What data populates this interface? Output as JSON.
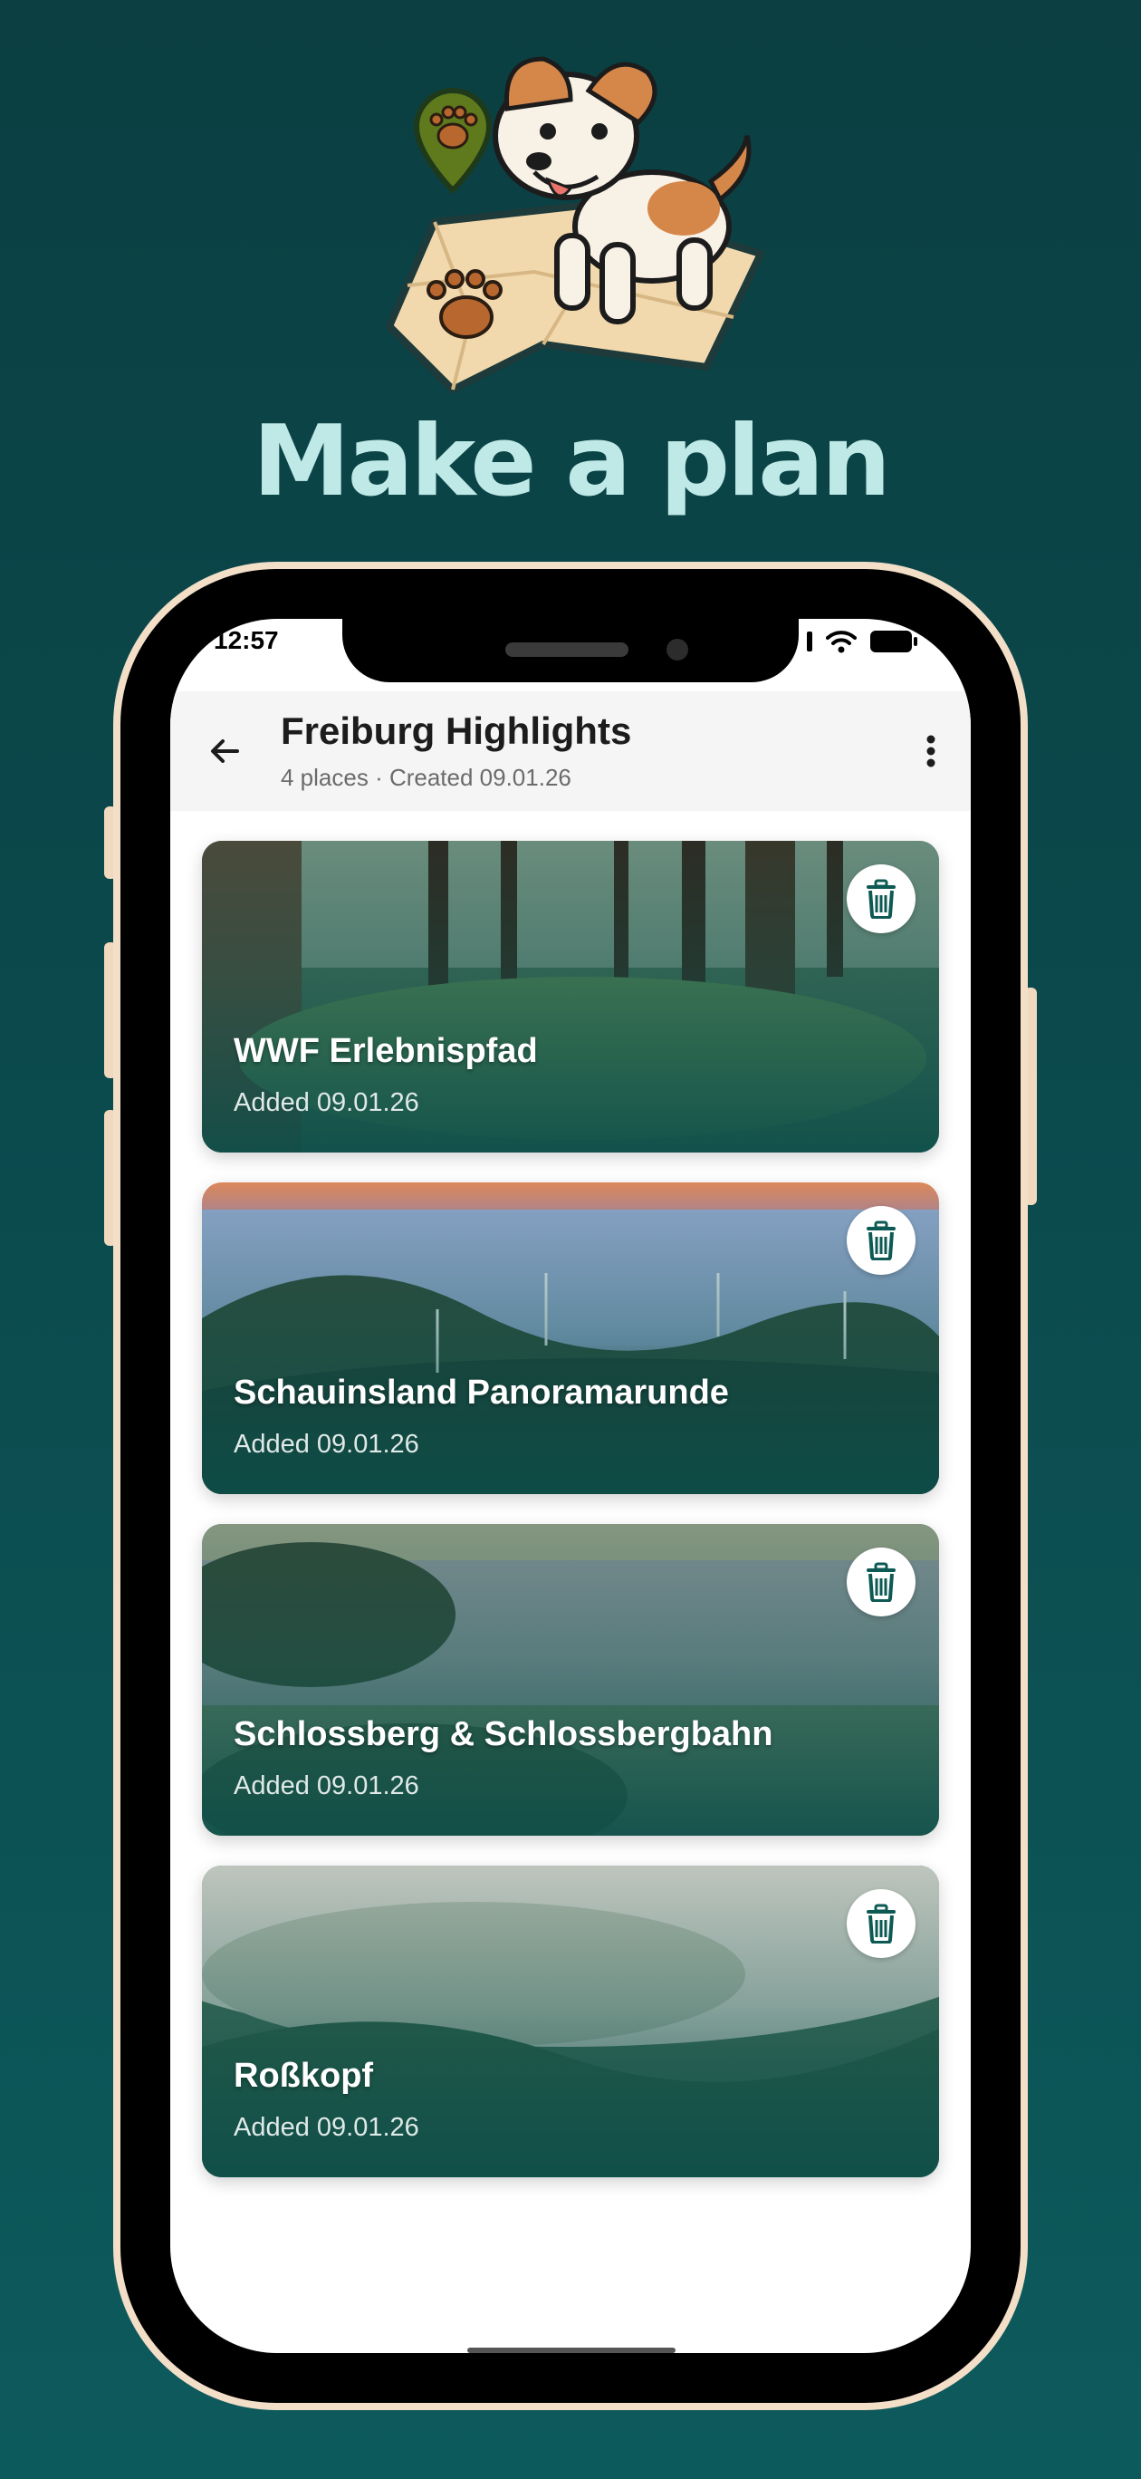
{
  "headline": "Make a plan",
  "status_bar": {
    "time": "12:57"
  },
  "plan": {
    "title": "Freiburg Highlights",
    "subtitle": "4 places · Created 09.01.26"
  },
  "places": [
    {
      "title": "WWF Erlebnispfad",
      "added": "Added 09.01.26"
    },
    {
      "title": "Schauinsland Panoramarunde",
      "added": "Added 09.01.26"
    },
    {
      "title": "Schlossberg & Schlossbergbahn",
      "added": "Added 09.01.26"
    },
    {
      "title": "Roßkopf",
      "added": "Added 09.01.26"
    }
  ],
  "colors": {
    "background": "#0b4a4d",
    "headline": "#bfe9e6",
    "phone_frame": "#f3dfc8",
    "accent": "#0d5a55",
    "pin": "#5f7a1c"
  },
  "icons": {
    "back": "arrow-left-icon",
    "menu": "more-vertical-icon",
    "delete": "trash-icon",
    "signal": "signal-icon",
    "wifi": "wifi-icon",
    "battery": "battery-icon"
  }
}
